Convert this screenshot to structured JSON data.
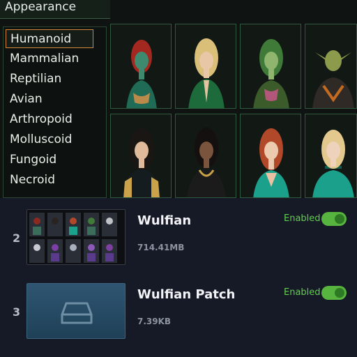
{
  "panel": {
    "title": "Appearance",
    "species": [
      "Humanoid",
      "Mammalian",
      "Reptilian",
      "Avian",
      "Arthropoid",
      "Molluscoid",
      "Fungoid",
      "Necroid"
    ],
    "selected_species": "Humanoid"
  },
  "portraits": [
    {
      "name": "portrait-red-hair-green-skin"
    },
    {
      "name": "portrait-blonde-elf-green-suit"
    },
    {
      "name": "portrait-green-skin-elf"
    },
    {
      "name": "portrait-goblin-armor"
    },
    {
      "name": "portrait-dark-hair-gold-armor"
    },
    {
      "name": "portrait-black-hair-black-dress"
    },
    {
      "name": "portrait-red-hair-teal-dress"
    },
    {
      "name": "portrait-blonde-teal-dress"
    }
  ],
  "mods": [
    {
      "index": "2",
      "name": "Wulfian",
      "size": "714.41MB",
      "status": "Enabled",
      "enabled": true,
      "thumb_icon": "portrait-grid-thumbnail"
    },
    {
      "index": "3",
      "name": "Wulfian Patch",
      "size": "7.39KB",
      "status": "Enabled",
      "enabled": true,
      "thumb_icon": "drive-icon"
    }
  ],
  "colors": {
    "accent_selected": "#d4883a",
    "panel_border": "#2f5a3f",
    "toggle_on": "#57b43f",
    "status_enabled": "#5fd14a",
    "background": "#161926"
  }
}
